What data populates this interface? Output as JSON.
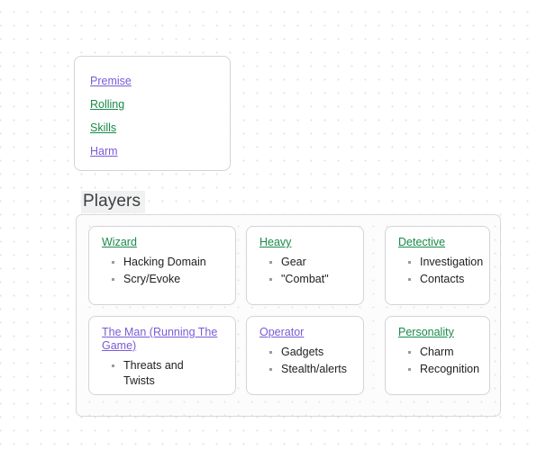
{
  "page": {
    "background_color": "#ffffff",
    "dot_color": "#e2e2e4",
    "link_green": "#1a8a4a",
    "link_purple": "#7b5bd6",
    "text_color": "#202124"
  },
  "nav_card": {
    "links": [
      {
        "label": "Premise",
        "state": "visited"
      },
      {
        "label": "Rolling",
        "state": "unvisited"
      },
      {
        "label": "Skills",
        "state": "unvisited"
      },
      {
        "label": "Harm",
        "state": "visited"
      }
    ]
  },
  "players_section": {
    "heading": "Players",
    "rows": [
      {
        "cards": [
          {
            "title": "Wizard",
            "title_state": "unvisited",
            "traits": [
              "Hacking Domain",
              "Scry/Evoke"
            ]
          },
          {
            "title": "Heavy",
            "title_state": "unvisited",
            "traits": [
              "Gear",
              "\"Combat\""
            ]
          },
          {
            "title": "Detective",
            "title_state": "unvisited",
            "traits": [
              "Investigation",
              "Contacts"
            ]
          }
        ]
      },
      {
        "cards": [
          {
            "title": "The Man (Running The Game)",
            "title_state": "visited",
            "traits": [
              "Threats and Twists"
            ]
          },
          {
            "title": "Operator",
            "title_state": "visited",
            "traits": [
              "Gadgets",
              "Stealth/alerts"
            ]
          },
          {
            "title": "Personality",
            "title_state": "unvisited",
            "traits": [
              "Charm",
              "Recognition"
            ]
          }
        ]
      }
    ]
  }
}
